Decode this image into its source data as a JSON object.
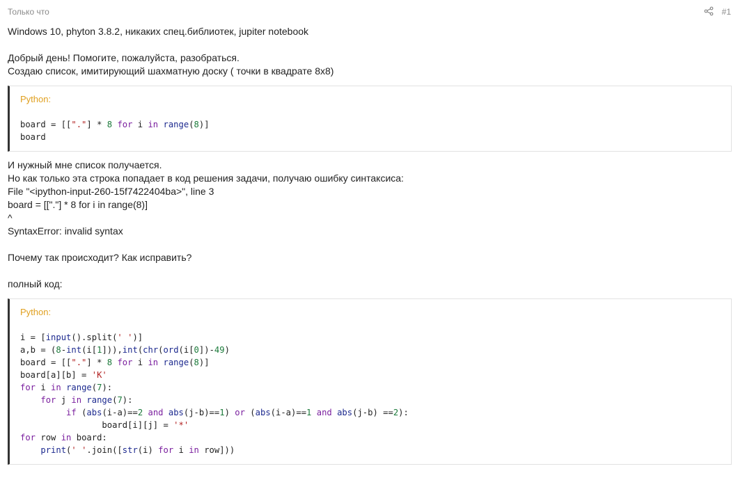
{
  "post": {
    "time": "Только что",
    "number": "#1",
    "share_icon": "share-icon",
    "intro": "Windows 10, phyton 3.8.2, никаких спец.библиотек, jupiter notebook",
    "greeting": "Добрый день! Помогите, пожалуйста, разобраться.",
    "description": "Создаю список, имитирующий шахматную доску ( точки в квадрате 8x8)",
    "code1_lang": "Python:",
    "error_lines": [
      "И нужный мне список получается.",
      "Но как только эта строка попадает в код решения задачи, получаю ошибку синтаксиса:",
      "File \"<ipython-input-260-15f7422404ba>\", line 3",
      "board = [[\".\"] * 8 for i in range(8)]",
      "^",
      "SyntaxError: invalid syntax"
    ],
    "question": "Почему так происходит? Как исправить?",
    "full_code_label": "полный код:",
    "code2_lang": "Python:"
  },
  "colors": {
    "keyword": "#7a1f9e",
    "builtin": "#1d2a8f",
    "number": "#1b7a3a",
    "string": "#b22222",
    "lang_label": "#e0a020",
    "block_border": "#333333"
  },
  "code1": [
    [
      {
        "t": "board = [[",
        "c": ""
      },
      {
        "t": "\".\"",
        "c": "st"
      },
      {
        "t": "] * ",
        "c": ""
      },
      {
        "t": "8",
        "c": "nm"
      },
      {
        "t": " ",
        "c": ""
      },
      {
        "t": "for",
        "c": "kw"
      },
      {
        "t": " i ",
        "c": ""
      },
      {
        "t": "in",
        "c": "kw"
      },
      {
        "t": " ",
        "c": ""
      },
      {
        "t": "range",
        "c": "bi"
      },
      {
        "t": "(",
        "c": ""
      },
      {
        "t": "8",
        "c": "nm"
      },
      {
        "t": ")]",
        "c": ""
      }
    ],
    [
      {
        "t": "board",
        "c": ""
      }
    ]
  ],
  "code2": [
    [
      {
        "t": "i = [",
        "c": ""
      },
      {
        "t": "input",
        "c": "bi"
      },
      {
        "t": "().split(",
        "c": ""
      },
      {
        "t": "' '",
        "c": "st"
      },
      {
        "t": ")]",
        "c": ""
      }
    ],
    [
      {
        "t": "a,b = (",
        "c": ""
      },
      {
        "t": "8",
        "c": "nm"
      },
      {
        "t": "-",
        "c": ""
      },
      {
        "t": "int",
        "c": "bi"
      },
      {
        "t": "(i[",
        "c": ""
      },
      {
        "t": "1",
        "c": "nm"
      },
      {
        "t": "])),",
        "c": ""
      },
      {
        "t": "int",
        "c": "bi"
      },
      {
        "t": "(",
        "c": ""
      },
      {
        "t": "chr",
        "c": "bi"
      },
      {
        "t": "(",
        "c": ""
      },
      {
        "t": "ord",
        "c": "bi"
      },
      {
        "t": "(i[",
        "c": ""
      },
      {
        "t": "0",
        "c": "nm"
      },
      {
        "t": "])-",
        "c": ""
      },
      {
        "t": "49",
        "c": "nm"
      },
      {
        "t": ")",
        "c": ""
      }
    ],
    [
      {
        "t": "board = [[",
        "c": ""
      },
      {
        "t": "\".\"",
        "c": "st"
      },
      {
        "t": "] * ",
        "c": ""
      },
      {
        "t": "8",
        "c": "nm"
      },
      {
        "t": " ",
        "c": ""
      },
      {
        "t": "for",
        "c": "kw"
      },
      {
        "t": " i ",
        "c": ""
      },
      {
        "t": "in",
        "c": "kw"
      },
      {
        "t": " ",
        "c": ""
      },
      {
        "t": "range",
        "c": "bi"
      },
      {
        "t": "(",
        "c": ""
      },
      {
        "t": "8",
        "c": "nm"
      },
      {
        "t": ")]",
        "c": ""
      }
    ],
    [
      {
        "t": "board[a][b] = ",
        "c": ""
      },
      {
        "t": "'K'",
        "c": "st"
      }
    ],
    [
      {
        "t": "for",
        "c": "kw"
      },
      {
        "t": " i ",
        "c": ""
      },
      {
        "t": "in",
        "c": "kw"
      },
      {
        "t": " ",
        "c": ""
      },
      {
        "t": "range",
        "c": "bi"
      },
      {
        "t": "(",
        "c": ""
      },
      {
        "t": "7",
        "c": "nm"
      },
      {
        "t": "):",
        "c": ""
      }
    ],
    [
      {
        "t": "    ",
        "c": ""
      },
      {
        "t": "for",
        "c": "kw"
      },
      {
        "t": " j ",
        "c": ""
      },
      {
        "t": "in",
        "c": "kw"
      },
      {
        "t": " ",
        "c": ""
      },
      {
        "t": "range",
        "c": "bi"
      },
      {
        "t": "(",
        "c": ""
      },
      {
        "t": "7",
        "c": "nm"
      },
      {
        "t": "):",
        "c": ""
      }
    ],
    [
      {
        "t": "         ",
        "c": ""
      },
      {
        "t": "if",
        "c": "kw"
      },
      {
        "t": " (",
        "c": ""
      },
      {
        "t": "abs",
        "c": "bi"
      },
      {
        "t": "(i-a)==",
        "c": ""
      },
      {
        "t": "2",
        "c": "nm"
      },
      {
        "t": " ",
        "c": ""
      },
      {
        "t": "and",
        "c": "kw"
      },
      {
        "t": " ",
        "c": ""
      },
      {
        "t": "abs",
        "c": "bi"
      },
      {
        "t": "(j-b)==",
        "c": ""
      },
      {
        "t": "1",
        "c": "nm"
      },
      {
        "t": ") ",
        "c": ""
      },
      {
        "t": "or",
        "c": "kw"
      },
      {
        "t": " (",
        "c": ""
      },
      {
        "t": "abs",
        "c": "bi"
      },
      {
        "t": "(i-a)==",
        "c": ""
      },
      {
        "t": "1",
        "c": "nm"
      },
      {
        "t": " ",
        "c": ""
      },
      {
        "t": "and",
        "c": "kw"
      },
      {
        "t": " ",
        "c": ""
      },
      {
        "t": "abs",
        "c": "bi"
      },
      {
        "t": "(j-b) ==",
        "c": ""
      },
      {
        "t": "2",
        "c": "nm"
      },
      {
        "t": "):",
        "c": ""
      }
    ],
    [
      {
        "t": "                ",
        "c": ""
      },
      {
        "t": "board[i][j] = ",
        "c": ""
      },
      {
        "t": "'*'",
        "c": "st"
      }
    ],
    [
      {
        "t": "for",
        "c": "kw"
      },
      {
        "t": " row ",
        "c": ""
      },
      {
        "t": "in",
        "c": "kw"
      },
      {
        "t": " board:",
        "c": ""
      }
    ],
    [
      {
        "t": "    ",
        "c": ""
      },
      {
        "t": "print",
        "c": "bi"
      },
      {
        "t": "(",
        "c": ""
      },
      {
        "t": "' '",
        "c": "st"
      },
      {
        "t": ".join([",
        "c": ""
      },
      {
        "t": "str",
        "c": "bi"
      },
      {
        "t": "(i) ",
        "c": ""
      },
      {
        "t": "for",
        "c": "kw"
      },
      {
        "t": " i ",
        "c": ""
      },
      {
        "t": "in",
        "c": "kw"
      },
      {
        "t": " row]))",
        "c": ""
      }
    ]
  ]
}
